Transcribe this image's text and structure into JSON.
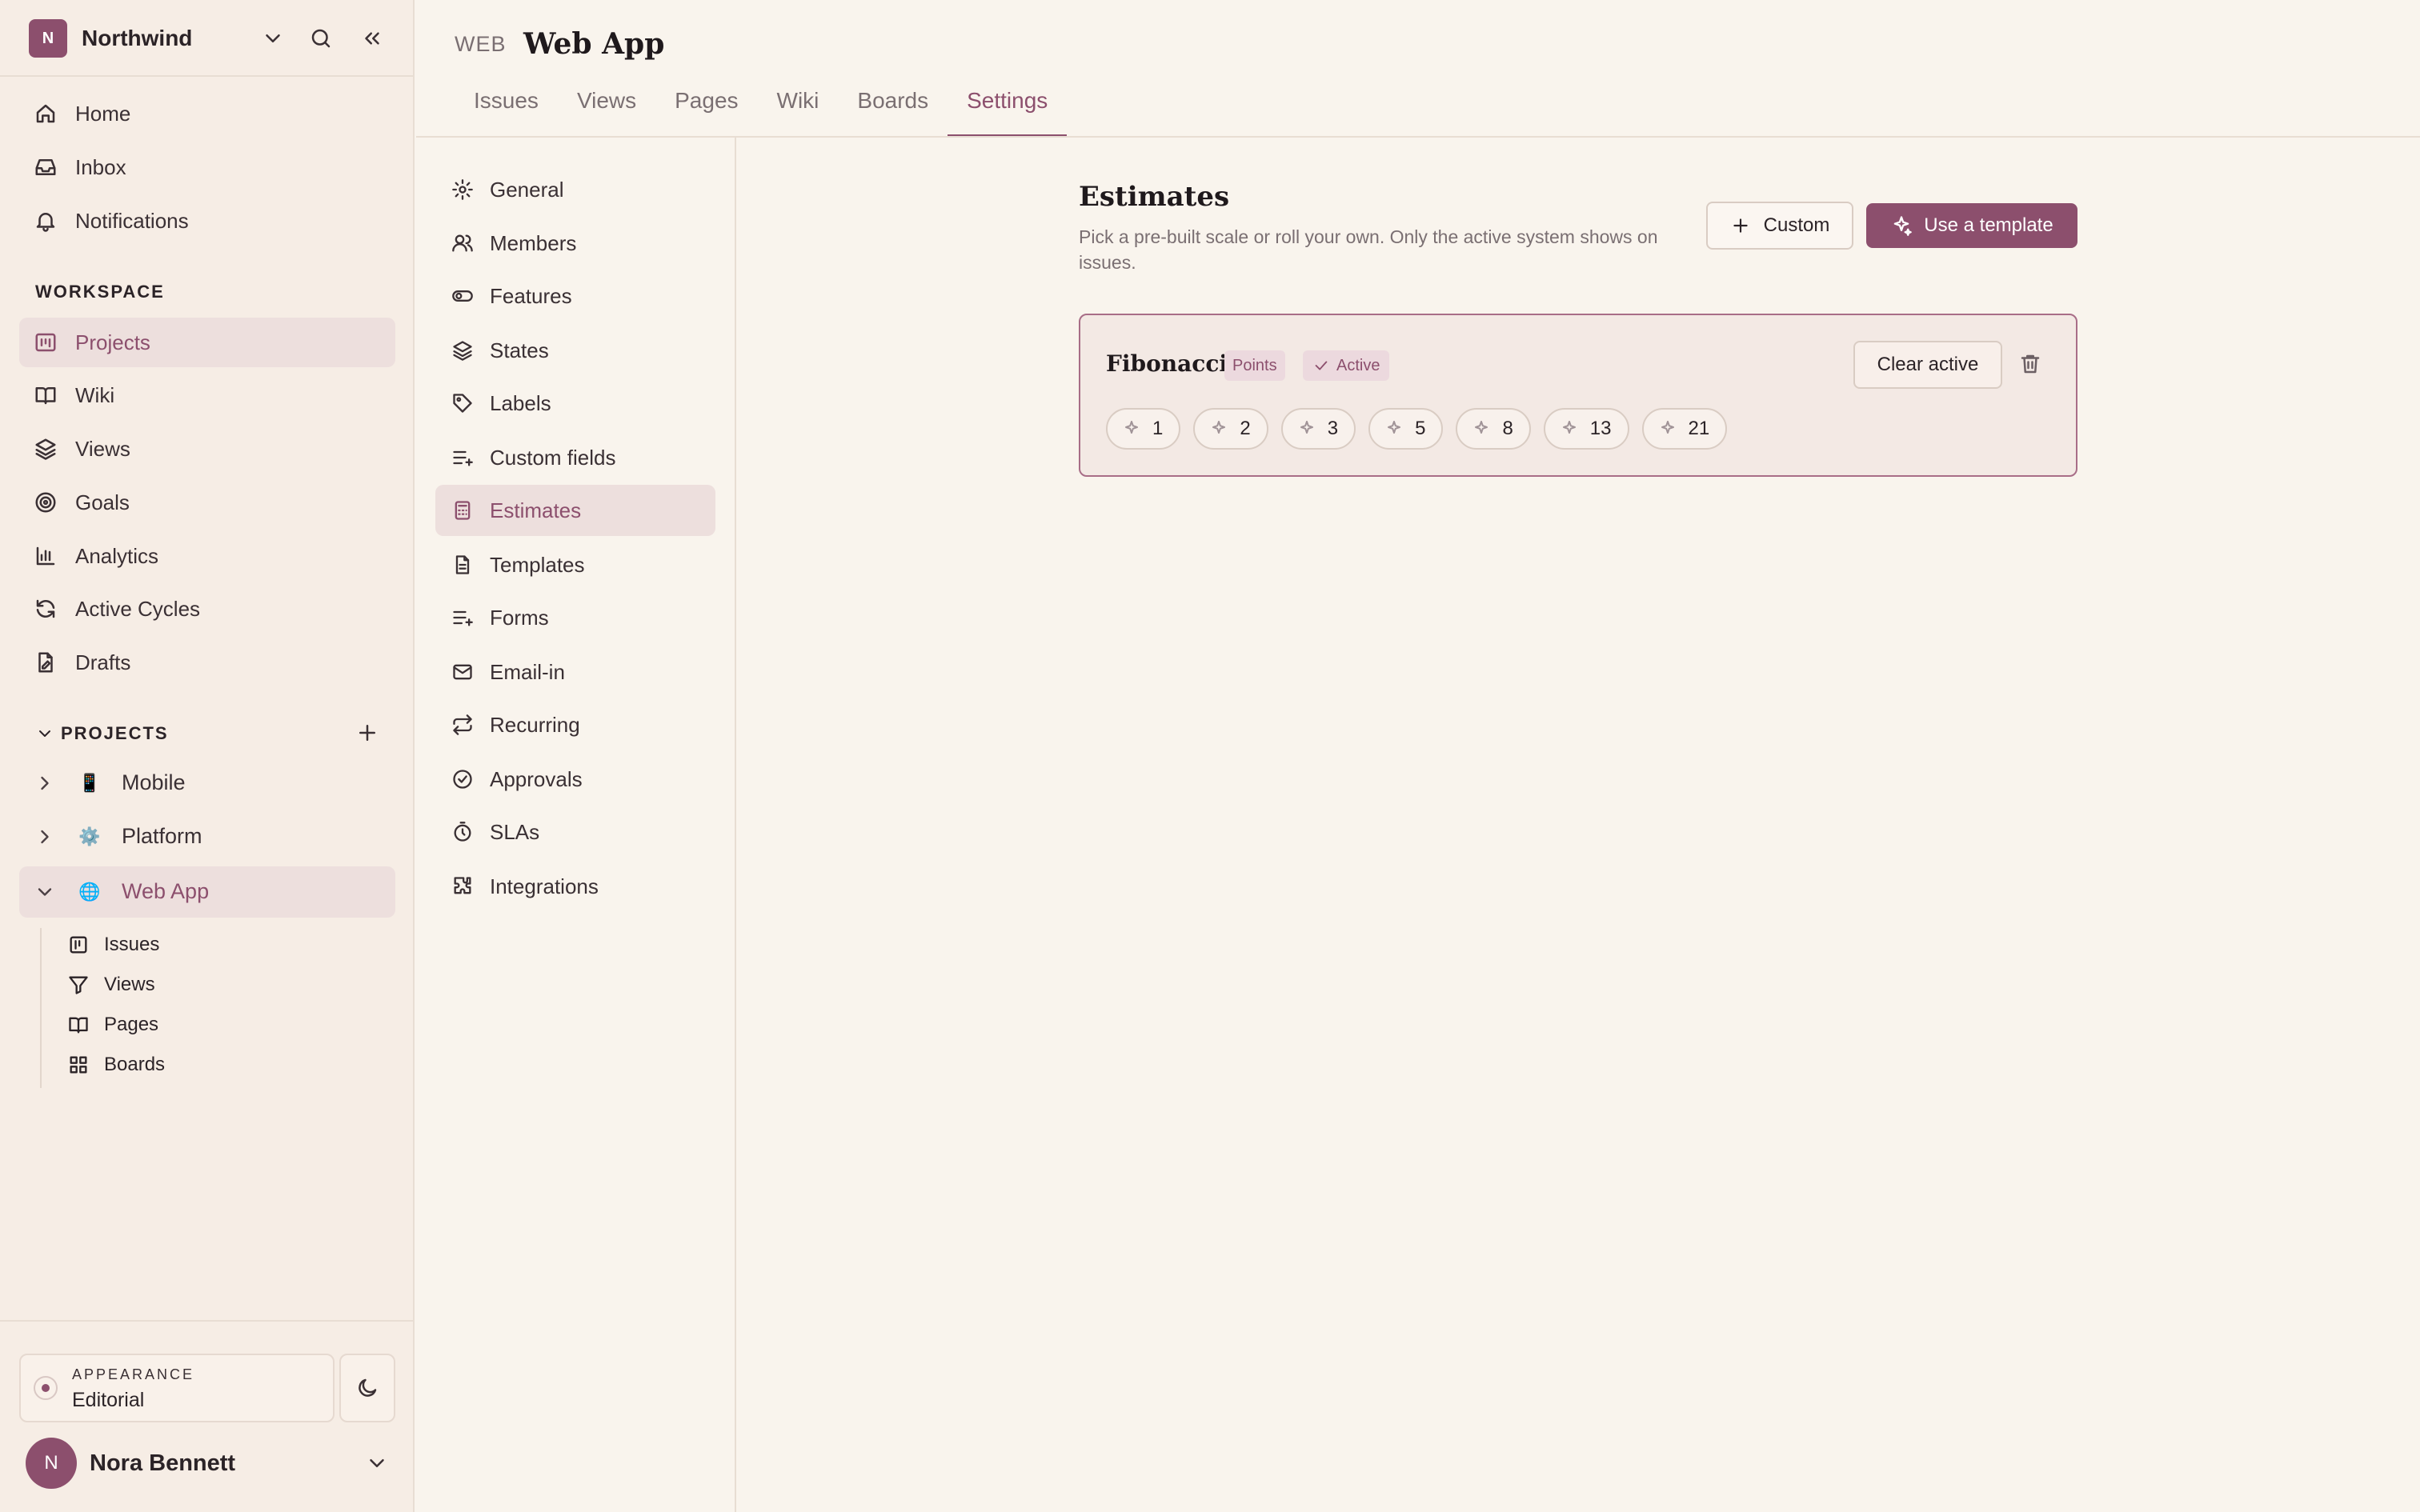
{
  "workspace": {
    "initial": "N",
    "name": "Northwind"
  },
  "nav": [
    {
      "label": "Home",
      "icon": "home-icon"
    },
    {
      "label": "Inbox",
      "icon": "inbox-icon"
    },
    {
      "label": "Notifications",
      "icon": "bell-icon"
    }
  ],
  "workspace_section": {
    "title": "WORKSPACE",
    "items": [
      {
        "label": "Projects",
        "icon": "projects-icon",
        "selected": true
      },
      {
        "label": "Wiki",
        "icon": "book-icon"
      },
      {
        "label": "Views",
        "icon": "layers-icon"
      },
      {
        "label": "Goals",
        "icon": "target-icon"
      },
      {
        "label": "Analytics",
        "icon": "bar-chart-icon"
      },
      {
        "label": "Active Cycles",
        "icon": "refresh-icon"
      },
      {
        "label": "Drafts",
        "icon": "draft-icon"
      }
    ]
  },
  "projects": {
    "title": "PROJECTS",
    "items": [
      {
        "name": "Mobile",
        "icon": "📱",
        "expanded": false
      },
      {
        "name": "Platform",
        "icon": "⚙️",
        "expanded": false
      },
      {
        "name": "Web App",
        "icon": "🌐",
        "expanded": true,
        "selected": true
      }
    ],
    "subitems": [
      {
        "label": "Issues",
        "icon": "issues-icon"
      },
      {
        "label": "Views",
        "icon": "filter-icon"
      },
      {
        "label": "Pages",
        "icon": "book-icon"
      },
      {
        "label": "Boards",
        "icon": "grid-icon"
      }
    ]
  },
  "appearance": {
    "caption": "APPEARANCE",
    "value": "Editorial"
  },
  "user": {
    "initial": "N",
    "name": "Nora Bennett"
  },
  "header": {
    "project_key": "WEB",
    "project_name": "Web App"
  },
  "tabs": [
    {
      "label": "Issues"
    },
    {
      "label": "Views"
    },
    {
      "label": "Pages"
    },
    {
      "label": "Wiki"
    },
    {
      "label": "Boards"
    },
    {
      "label": "Settings",
      "active": true
    }
  ],
  "settings_nav": [
    {
      "label": "General",
      "icon": "gear-icon"
    },
    {
      "label": "Members",
      "icon": "users-icon"
    },
    {
      "label": "Features",
      "icon": "toggle-icon"
    },
    {
      "label": "States",
      "icon": "layers-icon"
    },
    {
      "label": "Labels",
      "icon": "tag-icon"
    },
    {
      "label": "Custom fields",
      "icon": "list-plus-icon"
    },
    {
      "label": "Estimates",
      "icon": "calculator-icon",
      "selected": true
    },
    {
      "label": "Templates",
      "icon": "file-icon"
    },
    {
      "label": "Forms",
      "icon": "list-plus-icon"
    },
    {
      "label": "Email-in",
      "icon": "mail-icon"
    },
    {
      "label": "Recurring",
      "icon": "repeat-icon"
    },
    {
      "label": "Approvals",
      "icon": "check-circle-icon"
    },
    {
      "label": "SLAs",
      "icon": "timer-icon"
    },
    {
      "label": "Integrations",
      "icon": "puzzle-icon"
    }
  ],
  "estimates": {
    "title": "Estimates",
    "description": "Pick a pre-built scale or roll your own. Only the active system shows on issues.",
    "custom_label": "Custom",
    "template_label": "Use a template",
    "card": {
      "name": "Fibonacci",
      "type_badge": "Points",
      "status_badge": "Active",
      "clear_label": "Clear active",
      "values": [
        "1",
        "2",
        "3",
        "5",
        "8",
        "13",
        "21"
      ]
    }
  },
  "colors": {
    "accent": "#8c4f6d",
    "background": "#f9f4ed",
    "sidebar": "#f6ede5"
  }
}
